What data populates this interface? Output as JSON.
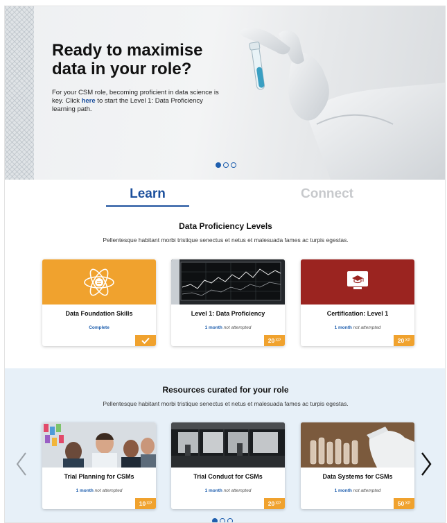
{
  "hero": {
    "title": "Ready to maximise data in your role?",
    "body_before": "For your CSM role, becoming proficient in data science is key. Click ",
    "link": "here",
    "body_after": " to start the Level 1: Data Proficiency learning path.",
    "carousel": {
      "total": 3,
      "active": 1
    }
  },
  "tabs": [
    {
      "label": "Learn",
      "active": true
    },
    {
      "label": "Connect",
      "active": false
    }
  ],
  "levels": {
    "title": "Data Proficiency Levels",
    "subtitle": "Pellentesque habitant morbi tristique senectus et netus et malesuada fames ac turpis egestas.",
    "cards": [
      {
        "title": "Data Foundation Skills",
        "status": "Complete",
        "badge_icon": "checkmark-icon",
        "media": "atom-icon",
        "media_color": "#f0a22e"
      },
      {
        "title": "Level 1: Data Proficiency",
        "status_highlight": "1 month",
        "status_rest": "not attempted",
        "xp": "20",
        "xp_unit": "XP",
        "media": "stock-chart-photo"
      },
      {
        "title": "Certification: Level 1",
        "status_highlight": "1 month",
        "status_rest": "not attempted",
        "xp": "20",
        "xp_unit": "XP",
        "media": "certificate-monitor-icon",
        "media_color": "#9b2420"
      }
    ]
  },
  "resources": {
    "title": "Resources curated for your role",
    "subtitle": "Pellentesque habitant morbi tristique senectus et netus et malesuada fames ac turpis egestas.",
    "cards": [
      {
        "title": "Trial Planning for CSMs",
        "status_highlight": "1 month",
        "status_rest": "not attempted",
        "xp": "10",
        "xp_unit": "XP",
        "media": "team-meeting-photo"
      },
      {
        "title": "Trial Conduct for CSMs",
        "status_highlight": "1 month",
        "status_rest": "not attempted",
        "xp": "20",
        "xp_unit": "XP",
        "media": "office-photo"
      },
      {
        "title": "Data Systems for CSMs",
        "status_highlight": "1 month",
        "status_rest": "not attempted",
        "xp": "50",
        "xp_unit": "XP",
        "media": "lab-vials-photo"
      }
    ],
    "carousel": {
      "total": 3,
      "active": 1
    }
  },
  "colors": {
    "brand_blue": "#1b4f9c",
    "accent_orange": "#f0a22e",
    "cert_red": "#9b2420",
    "resources_bg": "#e7f0f8"
  }
}
